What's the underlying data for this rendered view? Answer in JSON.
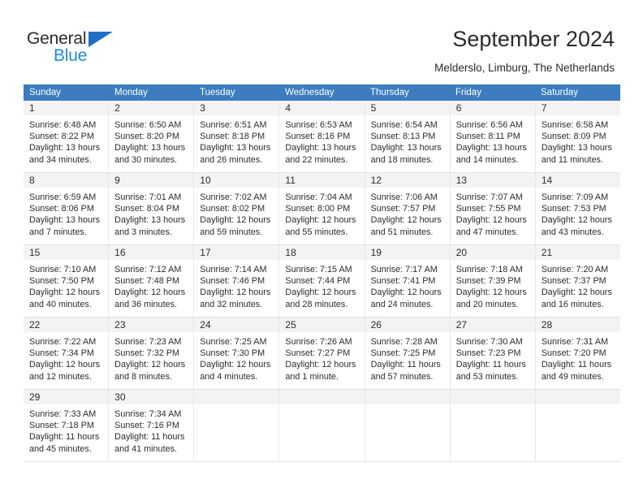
{
  "brand": {
    "name_part1": "General",
    "name_part2": "Blue",
    "triangle_color": "#1f6fc4",
    "blue_color": "#1f8ae0"
  },
  "header": {
    "title": "September 2024",
    "subtitle": "Melderslo, Limburg, The Netherlands"
  },
  "calendar": {
    "accent_color": "#3c7cbf",
    "band_color": "#f3f3f3",
    "weekdays": [
      "Sunday",
      "Monday",
      "Tuesday",
      "Wednesday",
      "Thursday",
      "Friday",
      "Saturday"
    ],
    "weeks": [
      [
        {
          "day": "1",
          "sunrise": "Sunrise: 6:48 AM",
          "sunset": "Sunset: 8:22 PM",
          "daylight1": "Daylight: 13 hours",
          "daylight2": "and 34 minutes."
        },
        {
          "day": "2",
          "sunrise": "Sunrise: 6:50 AM",
          "sunset": "Sunset: 8:20 PM",
          "daylight1": "Daylight: 13 hours",
          "daylight2": "and 30 minutes."
        },
        {
          "day": "3",
          "sunrise": "Sunrise: 6:51 AM",
          "sunset": "Sunset: 8:18 PM",
          "daylight1": "Daylight: 13 hours",
          "daylight2": "and 26 minutes."
        },
        {
          "day": "4",
          "sunrise": "Sunrise: 6:53 AM",
          "sunset": "Sunset: 8:16 PM",
          "daylight1": "Daylight: 13 hours",
          "daylight2": "and 22 minutes."
        },
        {
          "day": "5",
          "sunrise": "Sunrise: 6:54 AM",
          "sunset": "Sunset: 8:13 PM",
          "daylight1": "Daylight: 13 hours",
          "daylight2": "and 18 minutes."
        },
        {
          "day": "6",
          "sunrise": "Sunrise: 6:56 AM",
          "sunset": "Sunset: 8:11 PM",
          "daylight1": "Daylight: 13 hours",
          "daylight2": "and 14 minutes."
        },
        {
          "day": "7",
          "sunrise": "Sunrise: 6:58 AM",
          "sunset": "Sunset: 8:09 PM",
          "daylight1": "Daylight: 13 hours",
          "daylight2": "and 11 minutes."
        }
      ],
      [
        {
          "day": "8",
          "sunrise": "Sunrise: 6:59 AM",
          "sunset": "Sunset: 8:06 PM",
          "daylight1": "Daylight: 13 hours",
          "daylight2": "and 7 minutes."
        },
        {
          "day": "9",
          "sunrise": "Sunrise: 7:01 AM",
          "sunset": "Sunset: 8:04 PM",
          "daylight1": "Daylight: 13 hours",
          "daylight2": "and 3 minutes."
        },
        {
          "day": "10",
          "sunrise": "Sunrise: 7:02 AM",
          "sunset": "Sunset: 8:02 PM",
          "daylight1": "Daylight: 12 hours",
          "daylight2": "and 59 minutes."
        },
        {
          "day": "11",
          "sunrise": "Sunrise: 7:04 AM",
          "sunset": "Sunset: 8:00 PM",
          "daylight1": "Daylight: 12 hours",
          "daylight2": "and 55 minutes."
        },
        {
          "day": "12",
          "sunrise": "Sunrise: 7:06 AM",
          "sunset": "Sunset: 7:57 PM",
          "daylight1": "Daylight: 12 hours",
          "daylight2": "and 51 minutes."
        },
        {
          "day": "13",
          "sunrise": "Sunrise: 7:07 AM",
          "sunset": "Sunset: 7:55 PM",
          "daylight1": "Daylight: 12 hours",
          "daylight2": "and 47 minutes."
        },
        {
          "day": "14",
          "sunrise": "Sunrise: 7:09 AM",
          "sunset": "Sunset: 7:53 PM",
          "daylight1": "Daylight: 12 hours",
          "daylight2": "and 43 minutes."
        }
      ],
      [
        {
          "day": "15",
          "sunrise": "Sunrise: 7:10 AM",
          "sunset": "Sunset: 7:50 PM",
          "daylight1": "Daylight: 12 hours",
          "daylight2": "and 40 minutes."
        },
        {
          "day": "16",
          "sunrise": "Sunrise: 7:12 AM",
          "sunset": "Sunset: 7:48 PM",
          "daylight1": "Daylight: 12 hours",
          "daylight2": "and 36 minutes."
        },
        {
          "day": "17",
          "sunrise": "Sunrise: 7:14 AM",
          "sunset": "Sunset: 7:46 PM",
          "daylight1": "Daylight: 12 hours",
          "daylight2": "and 32 minutes."
        },
        {
          "day": "18",
          "sunrise": "Sunrise: 7:15 AM",
          "sunset": "Sunset: 7:44 PM",
          "daylight1": "Daylight: 12 hours",
          "daylight2": "and 28 minutes."
        },
        {
          "day": "19",
          "sunrise": "Sunrise: 7:17 AM",
          "sunset": "Sunset: 7:41 PM",
          "daylight1": "Daylight: 12 hours",
          "daylight2": "and 24 minutes."
        },
        {
          "day": "20",
          "sunrise": "Sunrise: 7:18 AM",
          "sunset": "Sunset: 7:39 PM",
          "daylight1": "Daylight: 12 hours",
          "daylight2": "and 20 minutes."
        },
        {
          "day": "21",
          "sunrise": "Sunrise: 7:20 AM",
          "sunset": "Sunset: 7:37 PM",
          "daylight1": "Daylight: 12 hours",
          "daylight2": "and 16 minutes."
        }
      ],
      [
        {
          "day": "22",
          "sunrise": "Sunrise: 7:22 AM",
          "sunset": "Sunset: 7:34 PM",
          "daylight1": "Daylight: 12 hours",
          "daylight2": "and 12 minutes."
        },
        {
          "day": "23",
          "sunrise": "Sunrise: 7:23 AM",
          "sunset": "Sunset: 7:32 PM",
          "daylight1": "Daylight: 12 hours",
          "daylight2": "and 8 minutes."
        },
        {
          "day": "24",
          "sunrise": "Sunrise: 7:25 AM",
          "sunset": "Sunset: 7:30 PM",
          "daylight1": "Daylight: 12 hours",
          "daylight2": "and 4 minutes."
        },
        {
          "day": "25",
          "sunrise": "Sunrise: 7:26 AM",
          "sunset": "Sunset: 7:27 PM",
          "daylight1": "Daylight: 12 hours",
          "daylight2": "and 1 minute."
        },
        {
          "day": "26",
          "sunrise": "Sunrise: 7:28 AM",
          "sunset": "Sunset: 7:25 PM",
          "daylight1": "Daylight: 11 hours",
          "daylight2": "and 57 minutes."
        },
        {
          "day": "27",
          "sunrise": "Sunrise: 7:30 AM",
          "sunset": "Sunset: 7:23 PM",
          "daylight1": "Daylight: 11 hours",
          "daylight2": "and 53 minutes."
        },
        {
          "day": "28",
          "sunrise": "Sunrise: 7:31 AM",
          "sunset": "Sunset: 7:20 PM",
          "daylight1": "Daylight: 11 hours",
          "daylight2": "and 49 minutes."
        }
      ],
      [
        {
          "day": "29",
          "sunrise": "Sunrise: 7:33 AM",
          "sunset": "Sunset: 7:18 PM",
          "daylight1": "Daylight: 11 hours",
          "daylight2": "and 45 minutes."
        },
        {
          "day": "30",
          "sunrise": "Sunrise: 7:34 AM",
          "sunset": "Sunset: 7:16 PM",
          "daylight1": "Daylight: 11 hours",
          "daylight2": "and 41 minutes."
        },
        {
          "day": "",
          "sunrise": "",
          "sunset": "",
          "daylight1": "",
          "daylight2": ""
        },
        {
          "day": "",
          "sunrise": "",
          "sunset": "",
          "daylight1": "",
          "daylight2": ""
        },
        {
          "day": "",
          "sunrise": "",
          "sunset": "",
          "daylight1": "",
          "daylight2": ""
        },
        {
          "day": "",
          "sunrise": "",
          "sunset": "",
          "daylight1": "",
          "daylight2": ""
        },
        {
          "day": "",
          "sunrise": "",
          "sunset": "",
          "daylight1": "",
          "daylight2": ""
        }
      ]
    ]
  }
}
